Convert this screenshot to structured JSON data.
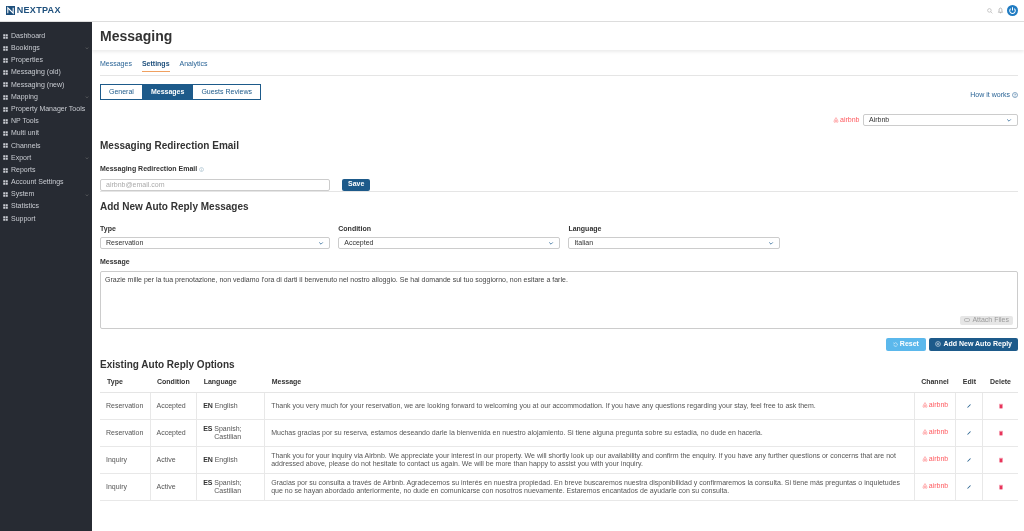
{
  "logo": {
    "text": "NEXTPAX"
  },
  "sidebar": {
    "items": [
      {
        "label": "Dashboard",
        "has_submenu": false
      },
      {
        "label": "Bookings",
        "has_submenu": true
      },
      {
        "label": "Properties",
        "has_submenu": false
      },
      {
        "label": "Messaging (old)",
        "has_submenu": false
      },
      {
        "label": "Messaging (new)",
        "has_submenu": false
      },
      {
        "label": "Mapping",
        "has_submenu": true
      },
      {
        "label": "Property Manager Tools",
        "has_submenu": false
      },
      {
        "label": "NP Tools",
        "has_submenu": false
      },
      {
        "label": "Multi unit",
        "has_submenu": false
      },
      {
        "label": "Channels",
        "has_submenu": false
      },
      {
        "label": "Export",
        "has_submenu": true
      },
      {
        "label": "Reports",
        "has_submenu": false
      },
      {
        "label": "Account Settings",
        "has_submenu": false
      },
      {
        "label": "System",
        "has_submenu": true
      },
      {
        "label": "Statistics",
        "has_submenu": false
      },
      {
        "label": "Support",
        "has_submenu": false
      }
    ]
  },
  "page_title": "Messaging",
  "tabs": [
    {
      "label": "Messages",
      "selected": false
    },
    {
      "label": "Settings",
      "selected": true
    },
    {
      "label": "Analytics",
      "selected": false
    }
  ],
  "subtabs": [
    {
      "label": "General",
      "selected": false
    },
    {
      "label": "Messages",
      "selected": true
    },
    {
      "label": "Guests Reviews",
      "selected": false
    }
  ],
  "how_it_works": "How it works",
  "channel_selector": {
    "brand": "airbnb",
    "value": "Airbnb"
  },
  "redirection": {
    "heading": "Messaging Redirection Email",
    "label": "Messaging Redirection Email",
    "placeholder": "airbnb@email.com",
    "save": "Save"
  },
  "new_reply": {
    "heading": "Add New Auto Reply Messages",
    "fields": [
      {
        "label": "Type",
        "value": "Reservation"
      },
      {
        "label": "Condition",
        "value": "Accepted"
      },
      {
        "label": "Language",
        "value": "Italian"
      }
    ],
    "message_label": "Message",
    "message": "Grazie mille per la tua prenotazione, non vediamo l'ora di darti il benvenuto nel nostro alloggio. Se hai domande sul tuo soggiorno, non esitare a farle.",
    "attach": {
      "label": "Attach Files",
      "disabled": true
    },
    "reset": "Reset",
    "add": "Add New Auto Reply"
  },
  "existing": {
    "heading": "Existing Auto Reply Options",
    "columns": [
      "Type",
      "Condition",
      "Language",
      "Message",
      "Channel",
      "Edit",
      "Delete"
    ],
    "rows": [
      {
        "type": "Reservation",
        "condition": "Accepted",
        "language_code": "EN",
        "language_name": "English",
        "message": "Thank you very much for your reservation, we are looking forward to welcoming you at our accommodation. If you have any questions regarding your stay, feel free to ask them.",
        "channel": "airbnb"
      },
      {
        "type": "Reservation",
        "condition": "Accepted",
        "language_code": "ES",
        "language_name": "Spanish; Castilian",
        "message": "Muchas gracias por su reserva, estamos deseando darle la bienvenida en nuestro alojamiento. Si tiene alguna pregunta sobre su estadía, no dude en hacerla.",
        "channel": "airbnb"
      },
      {
        "type": "Inquiry",
        "condition": "Active",
        "language_code": "EN",
        "language_name": "English",
        "message": "Thank you for your inquiry via Airbnb. We appreciate your interest in our property. We will shortly look up our availability and confirm the enquiry. If you have any further questions or concerns that are not addressed above, please do not hesitate to contact us again. We will be more than happy to assist you with your inquiry.",
        "channel": "airbnb"
      },
      {
        "type": "Inquiry",
        "condition": "Active",
        "language_code": "ES",
        "language_name": "Spanish; Castilian",
        "message": "Gracias por su consulta a través de Airbnb. Agradecemos su interés en nuestra propiedad. En breve buscaremos nuestra disponibilidad y confirmaremos la consulta. Si tiene más preguntas o inquietudes que no se hayan abordado anteriormente, no dude en comunicarse con nosotros nuevamente. Estaremos encantados de ayudarle con su consulta.",
        "channel": "airbnb"
      }
    ]
  }
}
